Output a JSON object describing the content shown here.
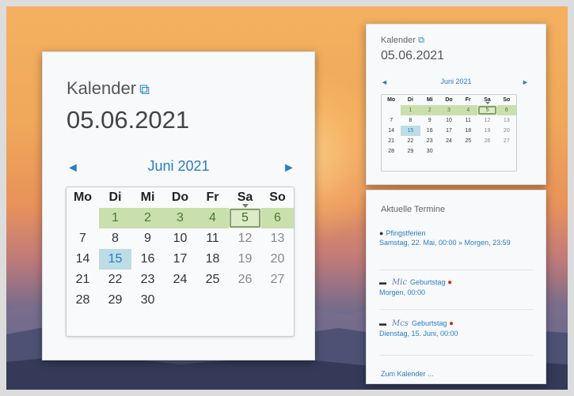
{
  "big_widget": {
    "title": "Kalender",
    "date": "05.06.2021",
    "month_label": "Juni 2021",
    "prev_symbol": "◄",
    "next_symbol": "►"
  },
  "small_widget": {
    "title": "Kalender",
    "date": "05.06.2021",
    "month_label": "Juni 2021",
    "prev_symbol": "◄",
    "next_symbol": "►"
  },
  "calendar": {
    "weekdays": [
      "Mo",
      "Di",
      "Mi",
      "Do",
      "Fr",
      "Sa",
      "So"
    ],
    "weeks": [
      [
        "",
        "1",
        "2",
        "3",
        "4",
        "5",
        "6"
      ],
      [
        "7",
        "8",
        "9",
        "10",
        "11",
        "12",
        "13"
      ],
      [
        "14",
        "15",
        "16",
        "17",
        "18",
        "19",
        "20"
      ],
      [
        "21",
        "22",
        "23",
        "24",
        "25",
        "26",
        "27"
      ],
      [
        "28",
        "29",
        "30",
        "",
        "",
        "",
        ""
      ]
    ],
    "selected_day": "5",
    "today": "15",
    "highlight_week_index": 0
  },
  "events": {
    "title": "Aktuelle Termine",
    "items": [
      {
        "icon": "globe-icon",
        "name": "Pfingstferien",
        "time": "Samstag, 22. Mai, 00:00 » Morgen, 23:59"
      },
      {
        "icon": "graduation-cap-icon",
        "name": "Geburtstag",
        "sig": "Mic",
        "time": "Morgen, 00:00"
      },
      {
        "icon": "graduation-cap-icon",
        "name": "Geburtstag",
        "sig": "Mcs",
        "time": "Dienstag, 15. Juni, 00:00"
      }
    ],
    "more_link": "Zum Kalender ..."
  }
}
